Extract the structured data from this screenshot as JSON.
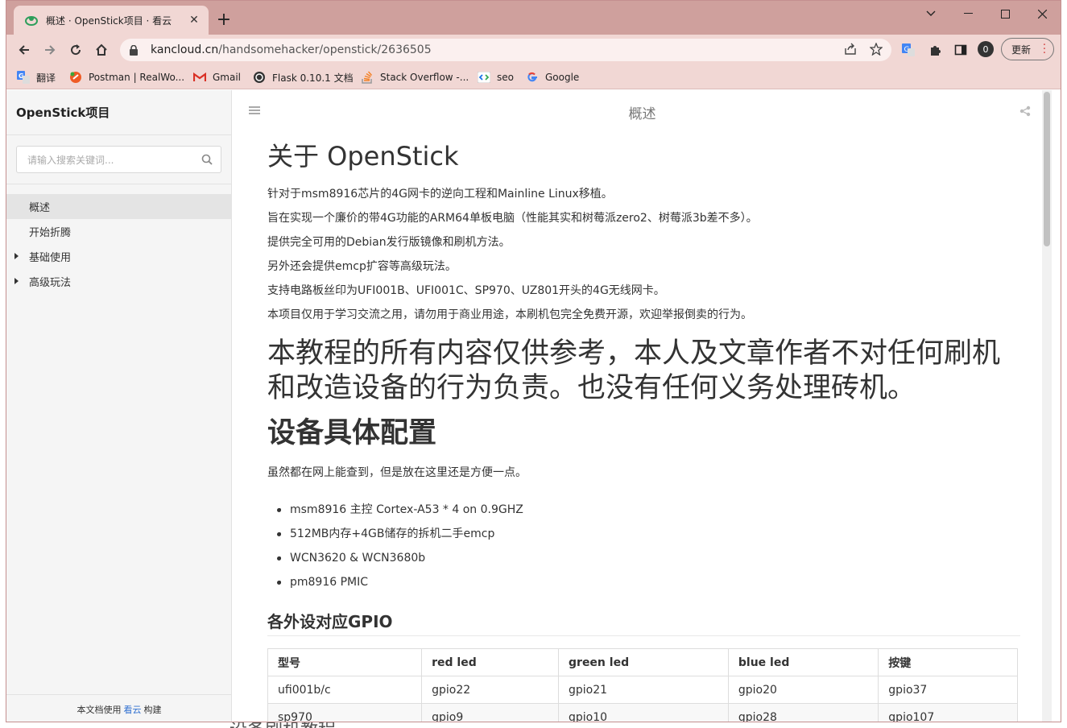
{
  "browser": {
    "tab": {
      "title": "概述 · OpenStick项目 · 看云"
    },
    "url_host": "kancloud.cn",
    "url_path": "/handsomehacker/openstick/2636505",
    "update_label": "更新",
    "profile_initial": "0",
    "bookmarks": [
      {
        "label": "翻译",
        "icon": "translate-icon"
      },
      {
        "label": "Postman | RealWo...",
        "icon": "postman-icon"
      },
      {
        "label": "Gmail",
        "icon": "gmail-icon"
      },
      {
        "label": "Flask 0.10.1 文档",
        "icon": "flask-icon"
      },
      {
        "label": "Stack Overflow -...",
        "icon": "stackoverflow-icon"
      },
      {
        "label": "seo",
        "icon": "seo-icon"
      },
      {
        "label": "Google",
        "icon": "google-icon"
      }
    ]
  },
  "sidebar": {
    "title": "OpenStick项目",
    "search_placeholder": "请输入搜索关键词...",
    "items": [
      {
        "label": "概述",
        "active": true,
        "expandable": false
      },
      {
        "label": "开始折腾",
        "active": false,
        "expandable": false
      },
      {
        "label": "基础使用",
        "active": false,
        "expandable": true
      },
      {
        "label": "高级玩法",
        "active": false,
        "expandable": true
      }
    ],
    "footer_prefix": "本文档使用",
    "footer_brand": "看云",
    "footer_suffix": "构建"
  },
  "header": {
    "title": "概述"
  },
  "article": {
    "h1": "关于 OpenStick",
    "intro": [
      "针对于msm8916芯片的4G网卡的逆向工程和Mainline Linux移植。",
      "旨在实现一个廉价的带4G功能的ARM64单板电脑（性能其实和树莓派zero2、树莓派3b差不多）。",
      "提供完全可用的Debian发行版镜像和刷机方法。",
      "另外还会提供emcp扩容等高级玩法。",
      "支持电路板丝印为UFI001B、UFI001C、SP970、UZ801开头的4G无线网卡。",
      "本项目仅用于学习交流之用，请勿用于商业用途，本刷机包完全免费开源，欢迎举报倒卖的行为。"
    ],
    "disclaimer": "本教程的所有内容仅供参考，本人及文章作者不对任何刷机和改造设备的行为负责。也没有任何义务处理砖机。",
    "config_heading": "设备具体配置",
    "config_note": "虽然都在网上能查到，但是放在这里还是方便一点。",
    "specs": [
      "msm8916 主控 Cortex-A53 * 4 on 0.9GHZ",
      "512MB内存+4GB储存的拆机二手emcp",
      "WCN3620 & WCN3680b",
      "pm8916 PMIC"
    ],
    "gpio_heading": "各外设对应GPIO",
    "gpio_table": {
      "headers": [
        "型号",
        "red led",
        "green led",
        "blue led",
        "按键"
      ],
      "rows": [
        [
          "ufi001b/c",
          "gpio22",
          "gpio21",
          "gpio20",
          "gpio37"
        ],
        [
          "sp970",
          "gpio9",
          "gpio10",
          "gpio28",
          "gpio107"
        ]
      ]
    },
    "next_heading_partial": "设备刷机教程"
  }
}
